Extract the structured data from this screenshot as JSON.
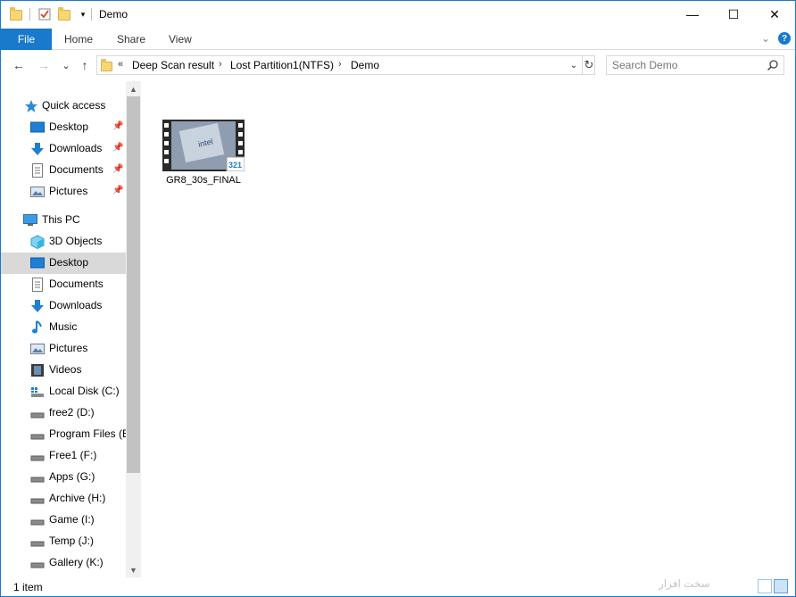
{
  "window": {
    "title": "Demo",
    "controls": {
      "minimize": "—",
      "maximize": "☐",
      "close": "✕"
    }
  },
  "ribbon": {
    "tabs": [
      {
        "label": "File"
      },
      {
        "label": "Home"
      },
      {
        "label": "Share"
      },
      {
        "label": "View"
      }
    ],
    "help_label": "?"
  },
  "navigation": {
    "back_icon": "←",
    "forward_icon": "→",
    "recent_icon": "⌄",
    "up_icon": "↑",
    "address": {
      "overflow": "«",
      "crumbs": [
        "Deep Scan result",
        "Lost Partition1(NTFS)",
        "Demo"
      ],
      "separator": "›"
    },
    "search_placeholder": "Search Demo"
  },
  "sidebar": {
    "quick_access": {
      "label": "Quick access",
      "items": [
        {
          "label": "Desktop",
          "icon": "desktop-icon",
          "pinned": true
        },
        {
          "label": "Downloads",
          "icon": "download-icon",
          "pinned": true
        },
        {
          "label": "Documents",
          "icon": "document-icon",
          "pinned": true
        },
        {
          "label": "Pictures",
          "icon": "pictures-icon",
          "pinned": true
        }
      ]
    },
    "this_pc": {
      "label": "This PC",
      "items": [
        {
          "label": "3D Objects",
          "icon": "3d-objects-icon"
        },
        {
          "label": "Desktop",
          "icon": "desktop-icon",
          "selected": true
        },
        {
          "label": "Documents",
          "icon": "document-icon"
        },
        {
          "label": "Downloads",
          "icon": "download-icon"
        },
        {
          "label": "Music",
          "icon": "music-icon"
        },
        {
          "label": "Pictures",
          "icon": "pictures-icon"
        },
        {
          "label": "Videos",
          "icon": "videos-icon"
        },
        {
          "label": "Local Disk (C:)",
          "icon": "windows-drive-icon"
        },
        {
          "label": "free2 (D:)",
          "icon": "drive-icon"
        },
        {
          "label": "Program Files (E",
          "icon": "drive-icon"
        },
        {
          "label": "Free1 (F:)",
          "icon": "drive-icon"
        },
        {
          "label": "Apps (G:)",
          "icon": "drive-icon"
        },
        {
          "label": "Archive (H:)",
          "icon": "drive-icon"
        },
        {
          "label": "Game (I:)",
          "icon": "drive-icon"
        },
        {
          "label": "Temp (J:)",
          "icon": "drive-icon"
        },
        {
          "label": "Gallery (K:)",
          "icon": "drive-icon"
        }
      ]
    }
  },
  "content": {
    "files": [
      {
        "name": "GR8_30s_FINAL",
        "icon": "video-file-icon",
        "badge": "321"
      }
    ]
  },
  "status": {
    "item_count": "1 item",
    "watermark": "سخت افزار"
  },
  "colors": {
    "accent": "#1979ca",
    "selected_row": "#d9d9d9",
    "folder_yellow": "#f7d774"
  }
}
